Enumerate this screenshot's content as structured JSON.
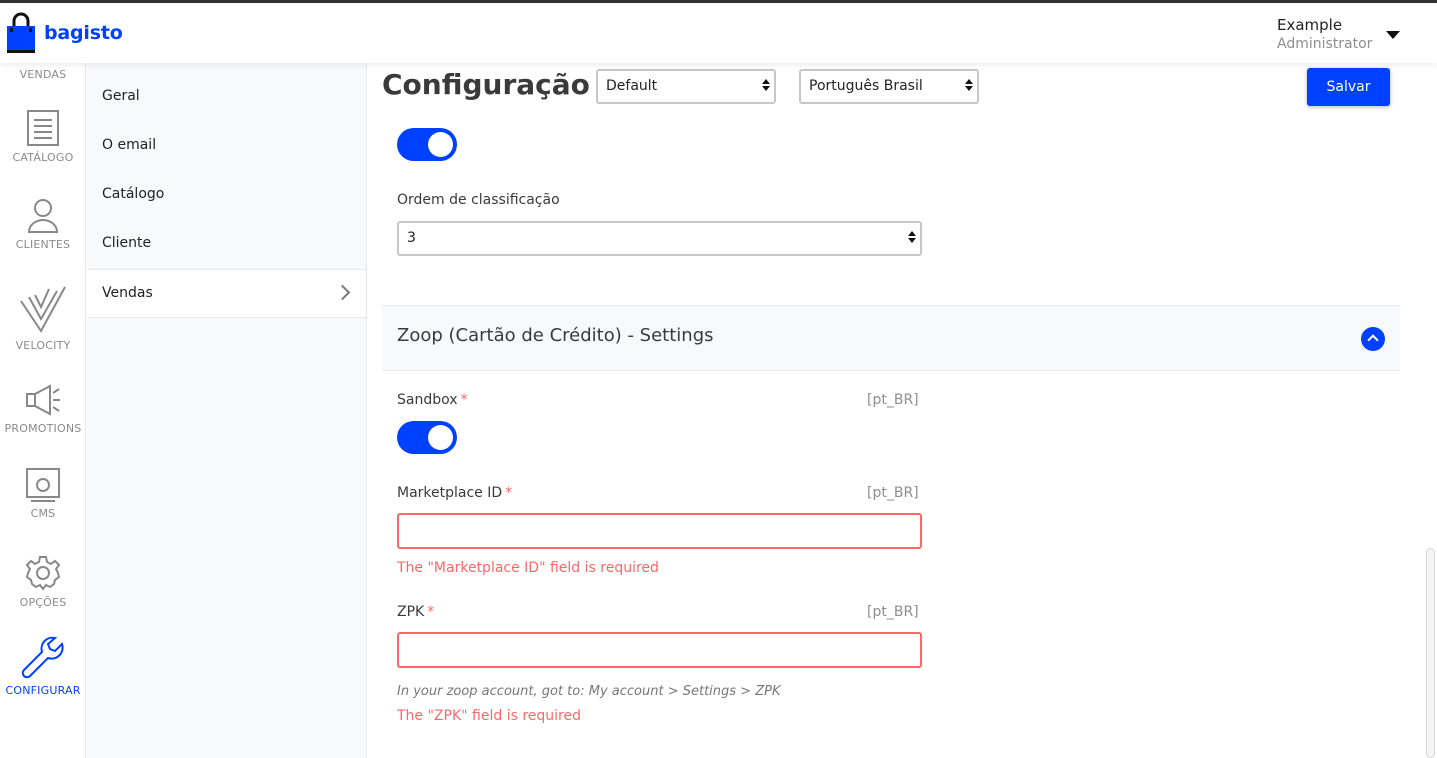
{
  "brand": {
    "name": "bagisto",
    "accent": "#0041ff",
    "error": "#fc6868"
  },
  "user": {
    "name": "Example",
    "role": "Administrator"
  },
  "nav": [
    {
      "label": "VENDAS",
      "icon": "sales-icon"
    },
    {
      "label": "CATÁLOGO",
      "icon": "catalog-icon"
    },
    {
      "label": "CLIENTES",
      "icon": "customer-icon"
    },
    {
      "label": "VELOCITY",
      "icon": "velocity-icon"
    },
    {
      "label": "PROMOTIONS",
      "icon": "megaphone-icon"
    },
    {
      "label": "CMS",
      "icon": "cms-icon"
    },
    {
      "label": "OPÇÕES",
      "icon": "gear-icon"
    },
    {
      "label": "CONFIGURAR",
      "icon": "wrench-icon",
      "active": true
    }
  ],
  "subnav": [
    {
      "label": "Geral"
    },
    {
      "label": "O email"
    },
    {
      "label": "Catálogo"
    },
    {
      "label": "Cliente"
    },
    {
      "label": "Vendas",
      "active": true
    }
  ],
  "page": {
    "title": "Configuração",
    "channel_select": "Default",
    "locale_select": "Português Brasil",
    "save_label": "Salvar"
  },
  "top_section": {
    "toggle_on": true,
    "sort_label": "Ordem de classificação",
    "sort_value": "3"
  },
  "zoop": {
    "title": "Zoop (Cartão de Crédito) - Settings",
    "sandbox": {
      "label": "Sandbox",
      "required": "*",
      "locale": "[pt_BR]",
      "on": true
    },
    "marketplace": {
      "label": "Marketplace ID",
      "required": "*",
      "locale": "[pt_BR]",
      "value": "",
      "error": "The \"Marketplace ID\" field is required"
    },
    "zpk": {
      "label": "ZPK",
      "required": "*",
      "locale": "[pt_BR]",
      "value": "",
      "hint": "In your zoop account, got to: My account > Settings > ZPK",
      "error": "The \"ZPK\" field is required"
    }
  }
}
